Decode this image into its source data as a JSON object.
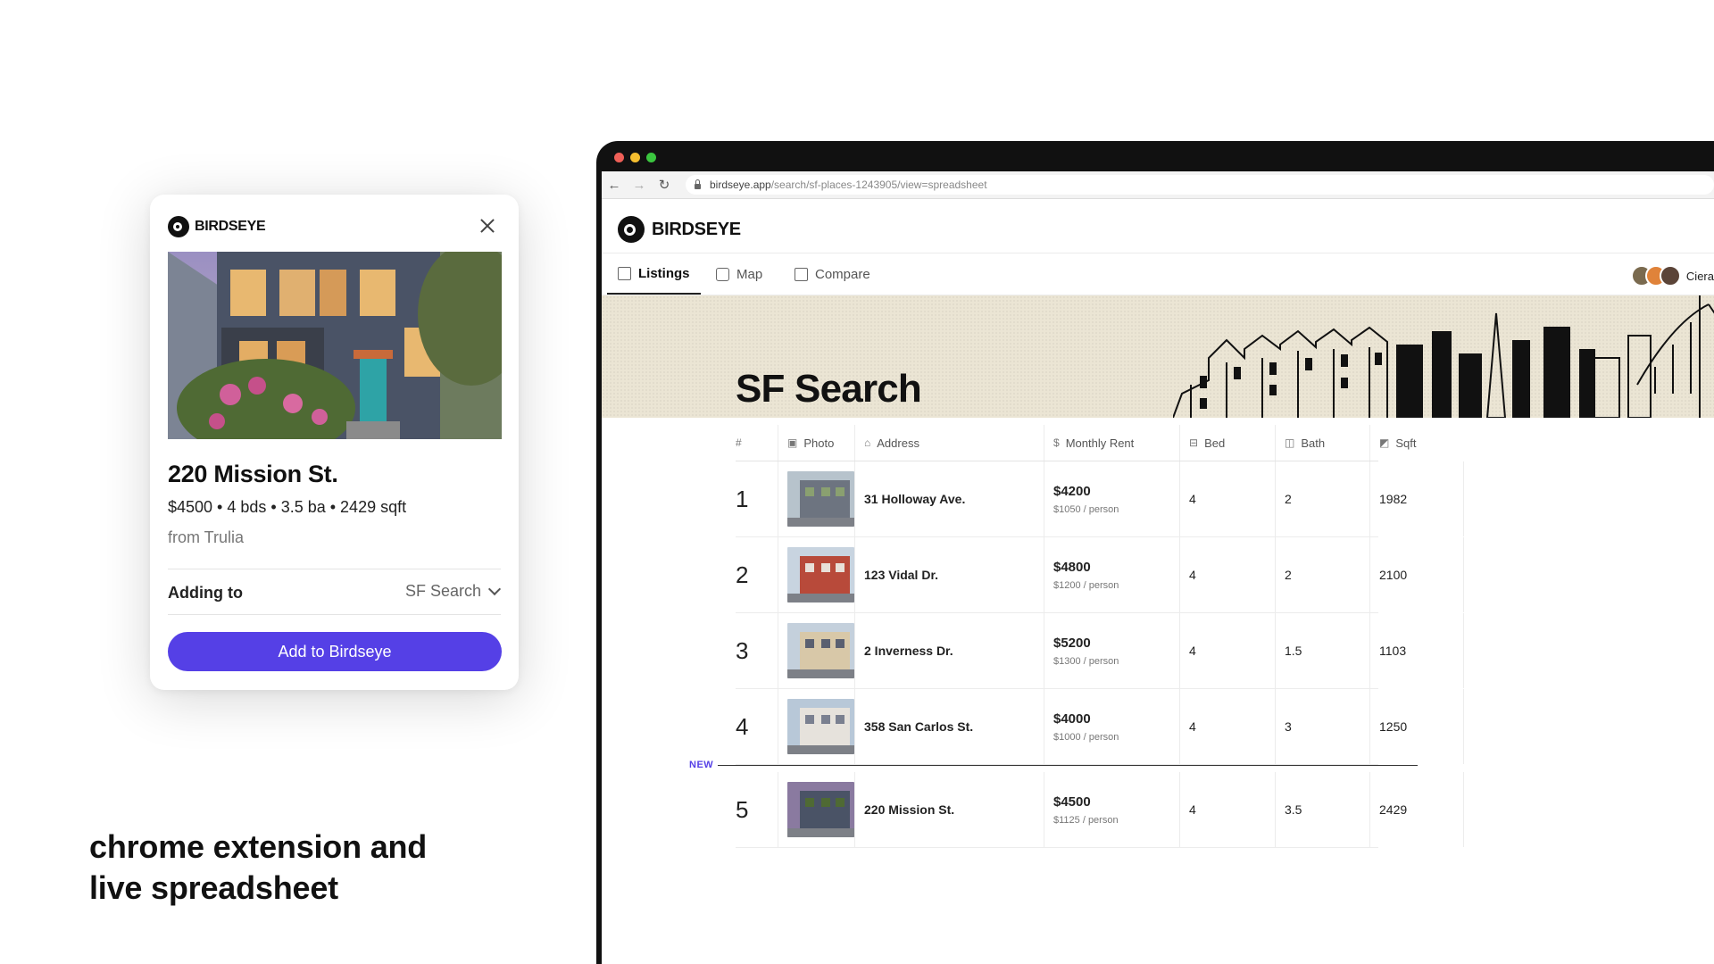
{
  "popup": {
    "brand": "BIRDSEYE",
    "title": "220 Mission St.",
    "meta": "$4500 • 4 bds • 3.5 ba • 2429 sqft",
    "source": "from Trulia",
    "adding_label": "Adding to",
    "adding_value": "SF Search",
    "add_button": "Add to Birdseye"
  },
  "caption": {
    "line1": "chrome extension and",
    "line2": "live spreadsheet"
  },
  "browser": {
    "url_domain": "birdseye.app",
    "url_path": "/search/sf-places-1243905/view=spreadsheet"
  },
  "app": {
    "brand": "BIRDSEYE",
    "tabs": [
      {
        "label": "Listings",
        "icon": "table-icon"
      },
      {
        "label": "Map",
        "icon": "map-icon"
      },
      {
        "label": "Compare",
        "icon": "compare-icon"
      }
    ],
    "user_name": "Ciera",
    "banner_title": "SF Search"
  },
  "table": {
    "headers": {
      "num": "#",
      "photo": "Photo",
      "address": "Address",
      "rent": "Monthly Rent",
      "bed": "Bed",
      "bath": "Bath",
      "sqft": "Sqft"
    },
    "new_label": "NEW",
    "rows": [
      {
        "num": "1",
        "address": "31 Holloway Ave.",
        "rent": "$4200",
        "per_person": "$1050 / person",
        "bed": "4",
        "bath": "2",
        "sqft": "1982"
      },
      {
        "num": "2",
        "address": "123 Vidal Dr.",
        "rent": "$4800",
        "per_person": "$1200 / person",
        "bed": "4",
        "bath": "2",
        "sqft": "2100"
      },
      {
        "num": "3",
        "address": "2 Inverness Dr.",
        "rent": "$5200",
        "per_person": "$1300 / person",
        "bed": "4",
        "bath": "1.5",
        "sqft": "1103"
      },
      {
        "num": "4",
        "address": "358 San Carlos St.",
        "rent": "$4000",
        "per_person": "$1000 / person",
        "bed": "4",
        "bath": "3",
        "sqft": "1250"
      },
      {
        "num": "5",
        "address": "220 Mission St.",
        "rent": "$4500",
        "per_person": "$1125 / person",
        "bed": "4",
        "bath": "3.5",
        "sqft": "2429"
      }
    ]
  },
  "colors": {
    "accent": "#5540e6",
    "banner": "#ebe5d4",
    "browser_frame": "#111111"
  }
}
